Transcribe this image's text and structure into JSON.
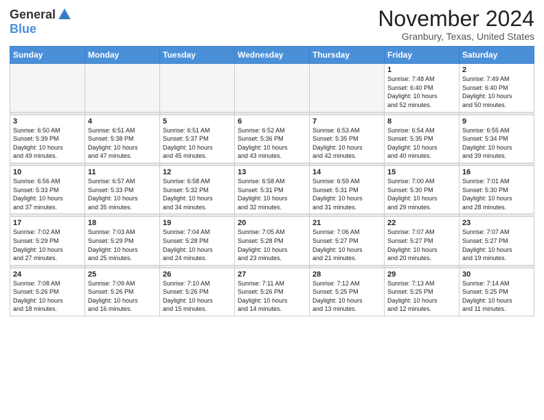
{
  "logo": {
    "general": "General",
    "blue": "Blue"
  },
  "title": "November 2024",
  "location": "Granbury, Texas, United States",
  "days_of_week": [
    "Sunday",
    "Monday",
    "Tuesday",
    "Wednesday",
    "Thursday",
    "Friday",
    "Saturday"
  ],
  "weeks": [
    [
      {
        "day": "",
        "info": "",
        "empty": true
      },
      {
        "day": "",
        "info": "",
        "empty": true
      },
      {
        "day": "",
        "info": "",
        "empty": true
      },
      {
        "day": "",
        "info": "",
        "empty": true
      },
      {
        "day": "",
        "info": "",
        "empty": true
      },
      {
        "day": "1",
        "info": "Sunrise: 7:48 AM\nSunset: 6:40 PM\nDaylight: 10 hours\nand 52 minutes."
      },
      {
        "day": "2",
        "info": "Sunrise: 7:49 AM\nSunset: 6:40 PM\nDaylight: 10 hours\nand 50 minutes."
      }
    ],
    [
      {
        "day": "3",
        "info": "Sunrise: 6:50 AM\nSunset: 5:39 PM\nDaylight: 10 hours\nand 49 minutes."
      },
      {
        "day": "4",
        "info": "Sunrise: 6:51 AM\nSunset: 5:38 PM\nDaylight: 10 hours\nand 47 minutes."
      },
      {
        "day": "5",
        "info": "Sunrise: 6:51 AM\nSunset: 5:37 PM\nDaylight: 10 hours\nand 45 minutes."
      },
      {
        "day": "6",
        "info": "Sunrise: 6:52 AM\nSunset: 5:36 PM\nDaylight: 10 hours\nand 43 minutes."
      },
      {
        "day": "7",
        "info": "Sunrise: 6:53 AM\nSunset: 5:35 PM\nDaylight: 10 hours\nand 42 minutes."
      },
      {
        "day": "8",
        "info": "Sunrise: 6:54 AM\nSunset: 5:35 PM\nDaylight: 10 hours\nand 40 minutes."
      },
      {
        "day": "9",
        "info": "Sunrise: 6:55 AM\nSunset: 5:34 PM\nDaylight: 10 hours\nand 39 minutes."
      }
    ],
    [
      {
        "day": "10",
        "info": "Sunrise: 6:56 AM\nSunset: 5:33 PM\nDaylight: 10 hours\nand 37 minutes."
      },
      {
        "day": "11",
        "info": "Sunrise: 6:57 AM\nSunset: 5:33 PM\nDaylight: 10 hours\nand 35 minutes."
      },
      {
        "day": "12",
        "info": "Sunrise: 6:58 AM\nSunset: 5:32 PM\nDaylight: 10 hours\nand 34 minutes."
      },
      {
        "day": "13",
        "info": "Sunrise: 6:58 AM\nSunset: 5:31 PM\nDaylight: 10 hours\nand 32 minutes."
      },
      {
        "day": "14",
        "info": "Sunrise: 6:59 AM\nSunset: 5:31 PM\nDaylight: 10 hours\nand 31 minutes."
      },
      {
        "day": "15",
        "info": "Sunrise: 7:00 AM\nSunset: 5:30 PM\nDaylight: 10 hours\nand 29 minutes."
      },
      {
        "day": "16",
        "info": "Sunrise: 7:01 AM\nSunset: 5:30 PM\nDaylight: 10 hours\nand 28 minutes."
      }
    ],
    [
      {
        "day": "17",
        "info": "Sunrise: 7:02 AM\nSunset: 5:29 PM\nDaylight: 10 hours\nand 27 minutes."
      },
      {
        "day": "18",
        "info": "Sunrise: 7:03 AM\nSunset: 5:29 PM\nDaylight: 10 hours\nand 25 minutes."
      },
      {
        "day": "19",
        "info": "Sunrise: 7:04 AM\nSunset: 5:28 PM\nDaylight: 10 hours\nand 24 minutes."
      },
      {
        "day": "20",
        "info": "Sunrise: 7:05 AM\nSunset: 5:28 PM\nDaylight: 10 hours\nand 23 minutes."
      },
      {
        "day": "21",
        "info": "Sunrise: 7:06 AM\nSunset: 5:27 PM\nDaylight: 10 hours\nand 21 minutes."
      },
      {
        "day": "22",
        "info": "Sunrise: 7:07 AM\nSunset: 5:27 PM\nDaylight: 10 hours\nand 20 minutes."
      },
      {
        "day": "23",
        "info": "Sunrise: 7:07 AM\nSunset: 5:27 PM\nDaylight: 10 hours\nand 19 minutes."
      }
    ],
    [
      {
        "day": "24",
        "info": "Sunrise: 7:08 AM\nSunset: 5:26 PM\nDaylight: 10 hours\nand 18 minutes."
      },
      {
        "day": "25",
        "info": "Sunrise: 7:09 AM\nSunset: 5:26 PM\nDaylight: 10 hours\nand 16 minutes."
      },
      {
        "day": "26",
        "info": "Sunrise: 7:10 AM\nSunset: 5:26 PM\nDaylight: 10 hours\nand 15 minutes."
      },
      {
        "day": "27",
        "info": "Sunrise: 7:11 AM\nSunset: 5:26 PM\nDaylight: 10 hours\nand 14 minutes."
      },
      {
        "day": "28",
        "info": "Sunrise: 7:12 AM\nSunset: 5:25 PM\nDaylight: 10 hours\nand 13 minutes."
      },
      {
        "day": "29",
        "info": "Sunrise: 7:13 AM\nSunset: 5:25 PM\nDaylight: 10 hours\nand 12 minutes."
      },
      {
        "day": "30",
        "info": "Sunrise: 7:14 AM\nSunset: 5:25 PM\nDaylight: 10 hours\nand 11 minutes."
      }
    ]
  ]
}
